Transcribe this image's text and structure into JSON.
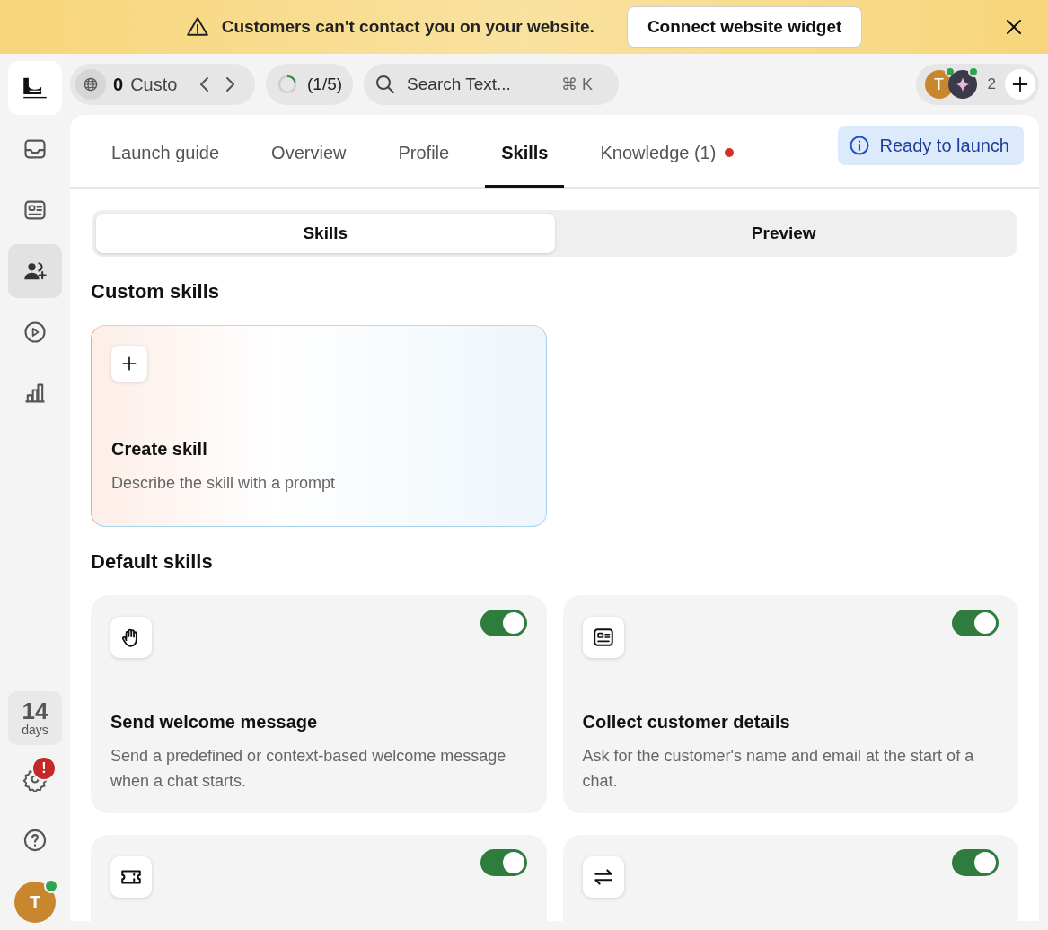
{
  "banner": {
    "message": "Customers can't contact you on your website.",
    "action": "Connect website widget"
  },
  "sidebar": {
    "items": [
      {
        "selected": false
      },
      {
        "selected": false
      },
      {
        "selected": true
      },
      {
        "selected": false
      },
      {
        "selected": false
      }
    ],
    "trial": {
      "count": "14",
      "unit": "days"
    },
    "settings_alert": "!",
    "avatar": "T"
  },
  "topbar": {
    "inbox": {
      "count": "0",
      "label": "Custo"
    },
    "progress": {
      "label": "(1/5)",
      "level": 0.2
    },
    "search": {
      "placeholder": "Search Text...",
      "shortcut": "⌘ K"
    },
    "team": {
      "avatar": "T",
      "count": "2"
    }
  },
  "tabs": [
    {
      "label": "Launch guide",
      "selected": false,
      "alert": false
    },
    {
      "label": "Overview",
      "selected": false,
      "alert": false
    },
    {
      "label": "Profile",
      "selected": false,
      "alert": false
    },
    {
      "label": "Skills",
      "selected": true,
      "alert": false
    },
    {
      "label": "Knowledge (1)",
      "selected": false,
      "alert": true
    }
  ],
  "status": "Ready to launch",
  "segments": [
    {
      "label": "Skills",
      "selected": true
    },
    {
      "label": "Preview",
      "selected": false
    }
  ],
  "custom_skills": {
    "heading": "Custom skills",
    "create": {
      "title": "Create skill",
      "description": "Describe the skill with a prompt"
    }
  },
  "default_skills": {
    "heading": "Default skills",
    "items": [
      {
        "title": "Send welcome message",
        "description": "Send a predefined or context-based welcome message when a chat starts.",
        "on": true
      },
      {
        "title": "Collect customer details",
        "description": "Ask for the customer's name and email at the start of a chat.",
        "on": true
      },
      {
        "on": true
      },
      {
        "on": true
      }
    ]
  }
}
